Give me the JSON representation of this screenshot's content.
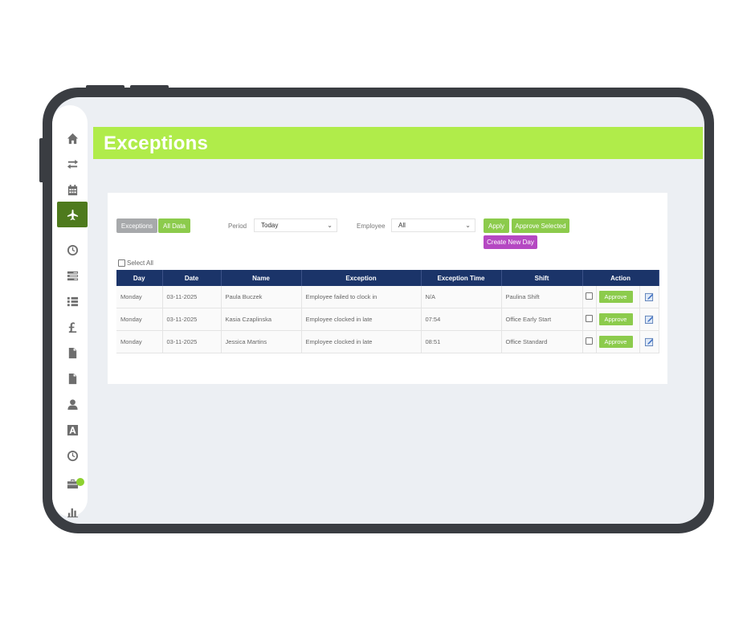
{
  "header": {
    "title": "Exceptions"
  },
  "sidebar": {
    "items": [
      {
        "icon": "home-icon"
      },
      {
        "icon": "transfer-icon"
      },
      {
        "icon": "calendar-icon"
      },
      {
        "icon": "plane-icon",
        "active": true
      },
      {
        "icon": "clock-icon"
      },
      {
        "icon": "timesheet-icon"
      },
      {
        "icon": "list-icon"
      },
      {
        "icon": "pound-icon"
      },
      {
        "icon": "document-icon"
      },
      {
        "icon": "document-alt-icon"
      },
      {
        "icon": "user-icon"
      },
      {
        "icon": "font-icon"
      },
      {
        "icon": "clock-alt-icon"
      },
      {
        "icon": "briefcase-icon"
      },
      {
        "icon": "bar-chart-icon"
      }
    ]
  },
  "toolbar": {
    "exceptions_label": "Exceptions",
    "all_data_label": "All Data",
    "period_label": "Period",
    "period_value": "Today",
    "employee_label": "Employee",
    "employee_value": "All",
    "apply_label": "Apply",
    "approve_selected_label": "Approve Selected",
    "create_new_day_label": "Create New Day"
  },
  "select_all_label": "Select All",
  "table": {
    "columns": [
      "Day",
      "Date",
      "Name",
      "Exception",
      "Exception Time",
      "Shift",
      "Action"
    ],
    "approve_label": "Approve",
    "rows": [
      {
        "day": "Monday",
        "date": "03-11-2025",
        "name": "Paula Buczek",
        "exception": "Employee failed to clock in",
        "time": "N/A",
        "shift": "Paulina Shift"
      },
      {
        "day": "Monday",
        "date": "03-11-2025",
        "name": "Kasia Czaplinska",
        "exception": "Employee clocked in late",
        "time": "07:54",
        "shift": "Office Early Start"
      },
      {
        "day": "Monday",
        "date": "03-11-2025",
        "name": "Jessica Martins",
        "exception": "Employee clocked in late",
        "time": "08:51",
        "shift": "Office Standard"
      }
    ]
  },
  "colors": {
    "banner": "#b0ec4a",
    "table_header": "#1b3469",
    "button_green": "#8ccb4c",
    "button_purple": "#b548c2",
    "nav_active": "#4e7a1d"
  }
}
